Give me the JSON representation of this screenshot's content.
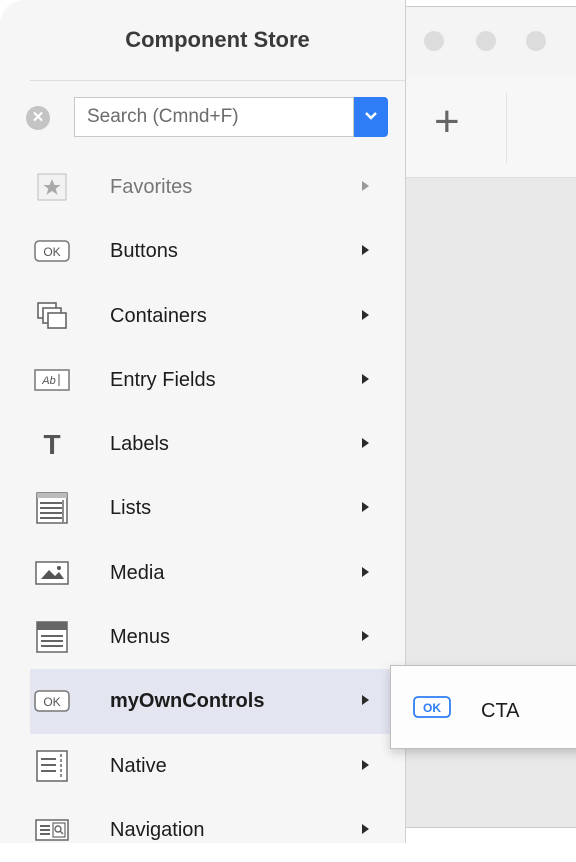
{
  "panel": {
    "title": "Component Store",
    "search": {
      "placeholder": "Search (Cmnd+F)",
      "value": ""
    }
  },
  "categories": [
    {
      "label": "Favorites",
      "icon": "star-icon",
      "state": "disabled"
    },
    {
      "label": "Buttons",
      "icon": "ok-button-icon"
    },
    {
      "label": "Containers",
      "icon": "containers-icon"
    },
    {
      "label": "Entry Fields",
      "icon": "entry-field-icon"
    },
    {
      "label": "Labels",
      "icon": "label-t-icon"
    },
    {
      "label": "Lists",
      "icon": "list-icon"
    },
    {
      "label": "Media",
      "icon": "media-icon"
    },
    {
      "label": "Menus",
      "icon": "menu-icon"
    },
    {
      "label": "myOwnControls",
      "icon": "ok-button-icon",
      "state": "selected"
    },
    {
      "label": "Native",
      "icon": "native-icon"
    },
    {
      "label": "Navigation",
      "icon": "navigation-icon"
    }
  ],
  "submenu": {
    "items": [
      {
        "label": "CTA",
        "icon": "ok-button-icon"
      }
    ]
  },
  "icon_text": {
    "ok": "OK",
    "ab": "Ab",
    "t": "T",
    "clear": "✕",
    "chevron": "⌄"
  },
  "toolbar": {
    "add": "+"
  },
  "colors": {
    "accent": "#2f7df6",
    "selected_row": "#e3e6f1",
    "panel_bg": "#f6f6f6"
  }
}
